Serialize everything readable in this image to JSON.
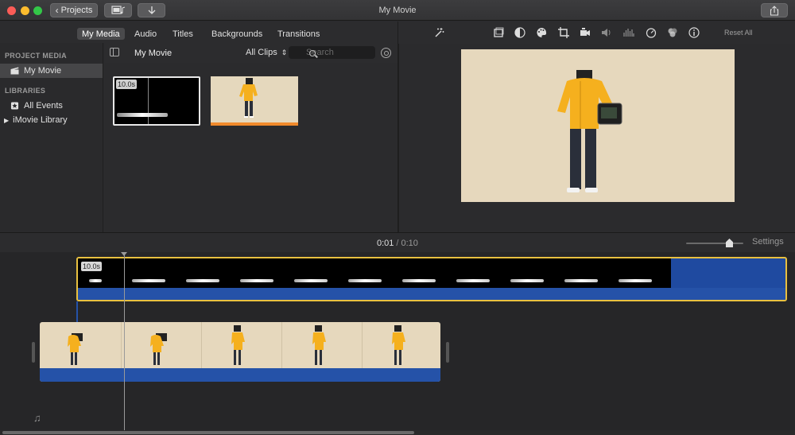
{
  "window": {
    "title": "My Movie"
  },
  "toolbar": {
    "projects_label": "Projects"
  },
  "browser": {
    "tabs": [
      {
        "label": "My Media",
        "active": true
      },
      {
        "label": "Audio"
      },
      {
        "label": "Titles"
      },
      {
        "label": "Backgrounds"
      },
      {
        "label": "Transitions"
      }
    ],
    "title": "My Movie",
    "filter": "All Clips",
    "search_placeholder": "Search",
    "clips": [
      {
        "duration": "10.0s"
      }
    ]
  },
  "sidebar": {
    "sections": [
      {
        "heading": "PROJECT MEDIA",
        "items": [
          {
            "label": "My Movie",
            "selected": true
          }
        ]
      },
      {
        "heading": "LIBRARIES",
        "items": [
          {
            "label": "All Events"
          },
          {
            "label": "iMovie Library"
          }
        ]
      }
    ]
  },
  "viewer": {
    "reset_label": "Reset All",
    "tools": [
      "magic-wand-icon",
      "crop-frame-icon",
      "color-balance-icon",
      "color-palette-icon",
      "crop-icon",
      "camera-stabilization-icon",
      "volume-icon",
      "equalizer-icon",
      "speed-icon",
      "filter-icon",
      "info-icon"
    ]
  },
  "timeline": {
    "current_time": "0:01",
    "total_time": "0:10",
    "settings_label": "Settings",
    "zoom_level": 0.75,
    "title_clip": {
      "duration": "10.0s"
    }
  },
  "colors": {
    "clip_selected_border": "#e8c040",
    "audio_track": "#2552a8",
    "title_bar": "#f08a2c"
  }
}
